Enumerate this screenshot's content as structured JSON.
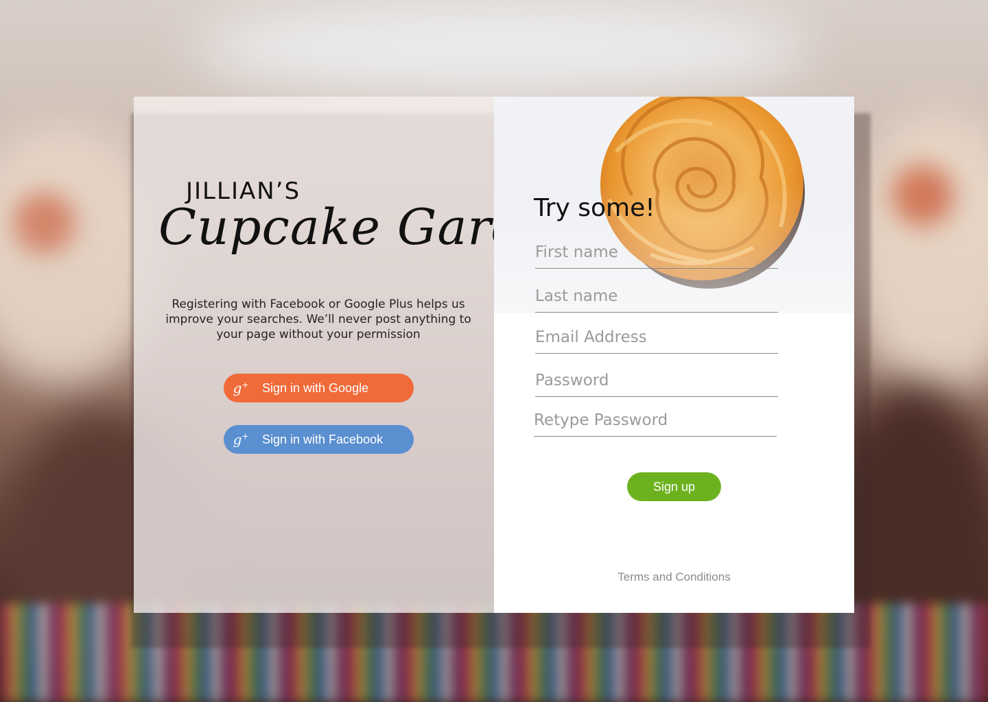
{
  "brand": {
    "top": "JILLIAN’S",
    "script": "Cupcake Garden"
  },
  "intro": {
    "text": "Registering with Facebook or Google Plus helps us improve your searches. We’ll never post anything to your page without your permission"
  },
  "social": {
    "google_label": "Sign in with Google",
    "facebook_label": "Sign in with Facebook",
    "icon_glyph": "g",
    "icon_sup": "+",
    "google_color": "#f06a3a",
    "facebook_color": "#5a8fd0"
  },
  "form": {
    "title": "Try some!",
    "first_name_placeholder": "First name",
    "last_name_placeholder": "Last name",
    "email_placeholder": "Email Address",
    "password_placeholder": "Password",
    "retype_password_placeholder": "Retype Password",
    "signup_label": "Sign up",
    "signup_color": "#6cb21e",
    "terms_label": "Terms and Conditions"
  }
}
